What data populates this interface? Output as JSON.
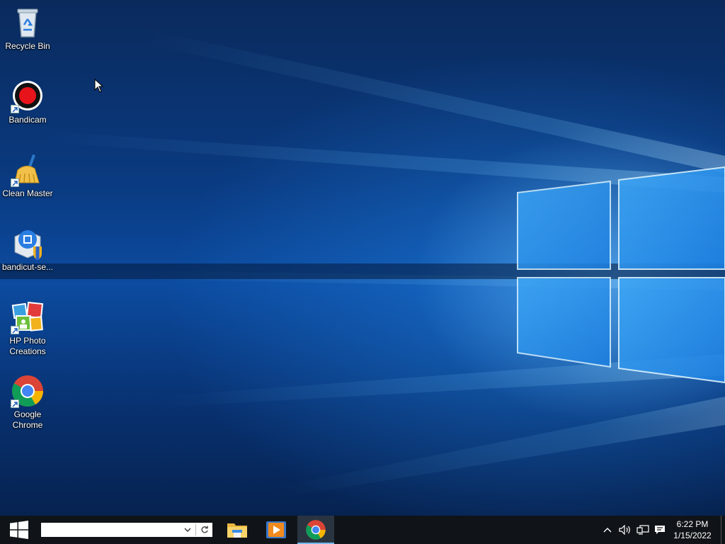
{
  "desktop": {
    "icons": [
      {
        "label": "Recycle Bin",
        "icon": "recycle-bin-icon"
      },
      {
        "label": "Bandicam",
        "icon": "bandicam-icon"
      },
      {
        "label": "Clean Master",
        "icon": "clean-master-icon"
      },
      {
        "label": "bandicut-se...",
        "icon": "bandicut-setup-icon"
      },
      {
        "label": "HP Photo Creations",
        "icon": "hp-photo-creations-icon"
      },
      {
        "label": "Google Chrome",
        "icon": "google-chrome-icon"
      }
    ]
  },
  "taskbar": {
    "start_icon": "windows-start-icon",
    "search": {
      "value": "",
      "placeholder": ""
    },
    "pinned_apps": [
      {
        "name": "file-explorer-icon"
      },
      {
        "name": "media-player-icon"
      },
      {
        "name": "google-chrome-icon",
        "active": true
      }
    ],
    "tray": {
      "icons": [
        "chevron-up-icon",
        "volume-icon",
        "network-icon",
        "notification-icon"
      ],
      "time": "6:22 PM",
      "date": "1/15/2022"
    }
  },
  "colors": {
    "taskbar_bg": "#101418",
    "active_indicator": "#76b9ed",
    "wallpaper_blue": "#0c4ba0"
  }
}
